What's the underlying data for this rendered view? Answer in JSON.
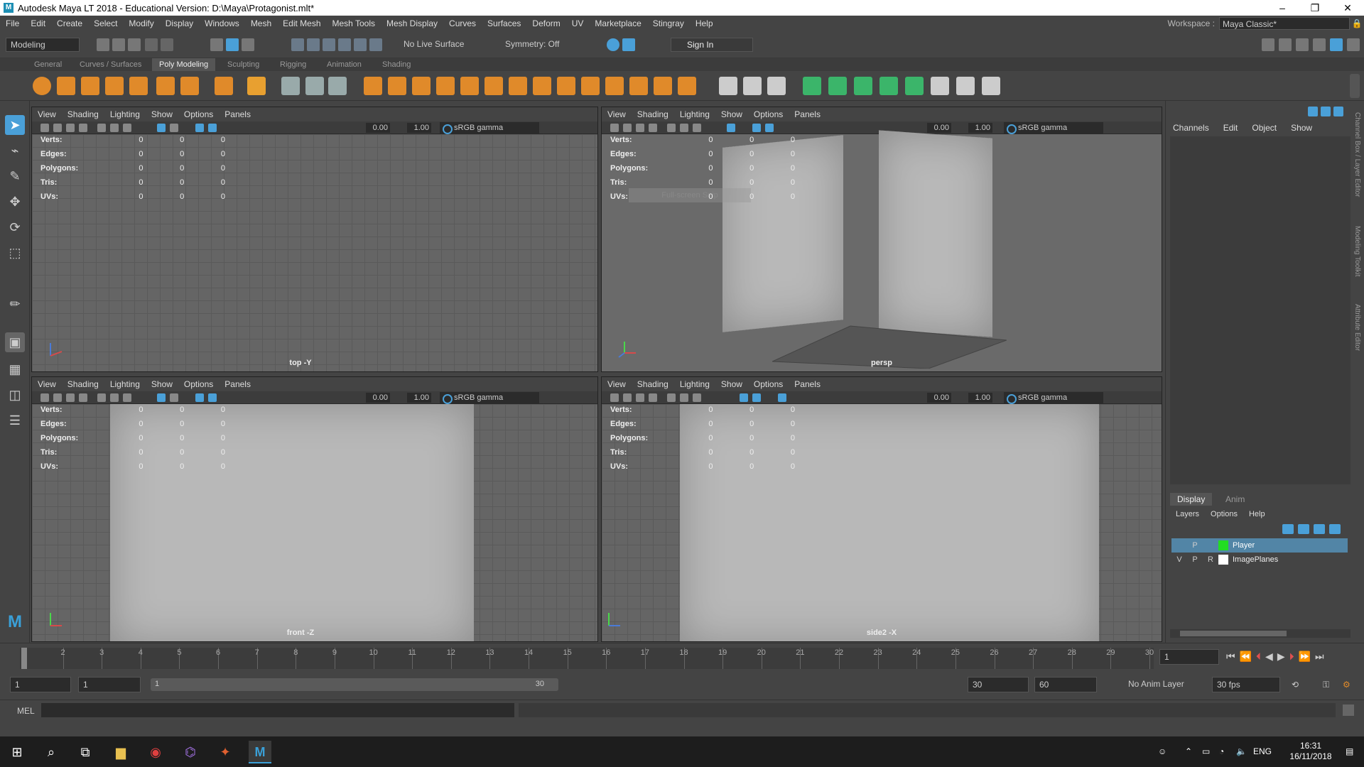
{
  "window": {
    "title": "Autodesk Maya LT 2018 - Educational Version: D:\\Maya\\Protagonist.mlt*",
    "min": "–",
    "max": "❐",
    "close": "✕"
  },
  "menubar": {
    "items": [
      "File",
      "Edit",
      "Create",
      "Select",
      "Modify",
      "Display",
      "Windows",
      "Mesh",
      "Edit Mesh",
      "Mesh Tools",
      "Mesh Display",
      "Curves",
      "Surfaces",
      "Deform",
      "UV",
      "Marketplace",
      "Stingray",
      "Help"
    ],
    "workspace_label": "Workspace :",
    "workspace_value": "Maya Classic*"
  },
  "statusline": {
    "mode": "Modeling",
    "live_surface": "No Live Surface",
    "symmetry": "Symmetry: Off",
    "sign_in": "Sign In"
  },
  "shelf": {
    "tabs": [
      "General",
      "Curves / Surfaces",
      "Poly Modeling",
      "Sculpting",
      "Rigging",
      "Animation",
      "Shading"
    ],
    "active": "Poly Modeling"
  },
  "viewport_menu": [
    "View",
    "Shading",
    "Lighting",
    "Show",
    "Options",
    "Panels"
  ],
  "viewport_toolbar": {
    "exposure": "0.00",
    "gamma": "1.00",
    "colorspace": "sRGB gamma"
  },
  "hud": {
    "labels": [
      "Verts:",
      "Edges:",
      "Polygons:",
      "Tris:",
      "UVs:"
    ],
    "value": "0"
  },
  "viewports": {
    "top": "top -Y",
    "persp": "persp",
    "front": "front -Z",
    "side": "side2 -X"
  },
  "snip_overlay": "Full-screen Snip",
  "channelbox": {
    "menu": [
      "Channels",
      "Edit",
      "Object",
      "Show"
    ],
    "side_tabs": [
      "Channel Box / Layer Editor",
      "Modeling Toolkit",
      "Attribute Editor"
    ]
  },
  "layers": {
    "tabs": [
      "Display",
      "Anim"
    ],
    "menu": [
      "Layers",
      "Options",
      "Help"
    ],
    "rows": [
      {
        "v": "",
        "p": "P",
        "r": "",
        "name": "Player",
        "color": "#22dd22",
        "selected": true
      },
      {
        "v": "V",
        "p": "P",
        "r": "R",
        "name": "ImagePlanes",
        "color": "#ffffff",
        "selected": false
      }
    ]
  },
  "timeline": {
    "ticks": [
      "1",
      "2",
      "3",
      "4",
      "5",
      "6",
      "7",
      "8",
      "9",
      "10",
      "11",
      "12",
      "13",
      "14",
      "15",
      "16",
      "17",
      "18",
      "19",
      "20",
      "21",
      "22",
      "23",
      "24",
      "25",
      "26",
      "27",
      "28",
      "29",
      "30"
    ],
    "current_frame": "1"
  },
  "range": {
    "start": "1",
    "inner_start": "1",
    "slider_start": "1",
    "slider_end": "30",
    "end": "30",
    "anim_end": "60",
    "anim_layer": "No Anim Layer",
    "fps": "30 fps"
  },
  "cmdline": {
    "label": "MEL"
  },
  "taskbar": {
    "lang": "ENG",
    "time": "16:31",
    "date": "16/11/2018"
  }
}
